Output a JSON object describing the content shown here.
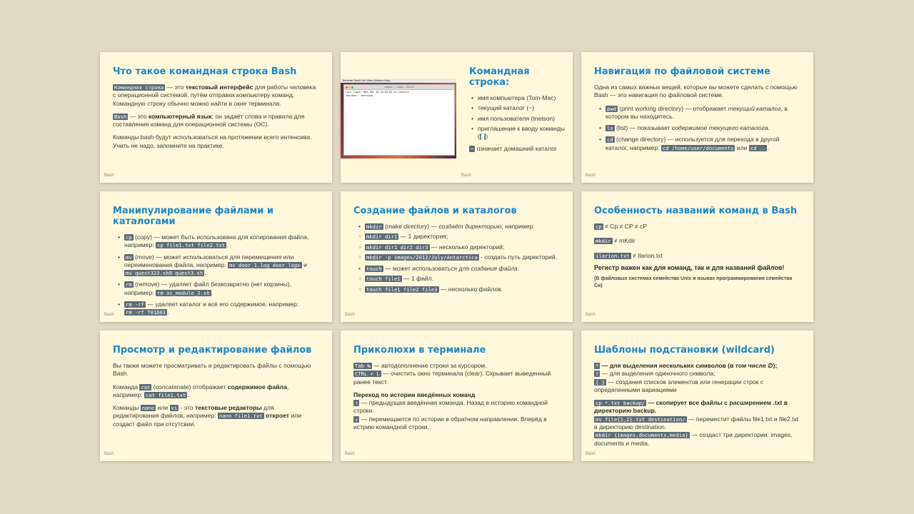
{
  "footer_label": "Bash",
  "s1": {
    "title": "Что такое командная строка Bash",
    "p1_code": "Командная строка",
    "p1_a": " — это ",
    "p1_b": "текстовый интерфейс",
    "p1_c": " для работы человека с операционной системой, путём отправки компьютеру команд. Командную строку обычно можно найти в окне терминала.",
    "p2_code": "Bash",
    "p2_a": " — это ",
    "p2_b": "компьютерный язык",
    "p2_c": "; он задаёт слова и правила для составления команд для операционной системы (ОС).",
    "p3": "Команды bash будут использоваться на протяжении всего интенсива. Учить не надо, запомните на практике."
  },
  "s2": {
    "title": "Командная строка:",
    "items": [
      "имя компьютера (Tom-Mac)",
      "текущий каталог (~)",
      "имя пользователя (tnelson)",
      "приглашение к вводу команды ("
    ],
    "cursor_close": ")",
    "note_code": "~",
    "note": " означает домашний каталог",
    "term_menu": "Terminal   Shell   Edit   View   Window   Help",
    "term_title": "tnelson — -bash — 80×24",
    "term_line1": "Last login: Mon Dec 16 14:03:02 on console",
    "term_line2": "Tom-Mac:~ tnelson$"
  },
  "s3": {
    "title": "Навигация по файловой системе",
    "intro": "Одна из самых важных вещей, которые вы можете сделать с помощью Bash — это навигация по файловой системе.",
    "i1_code": "pwd",
    "i1_a": " (print working directory) — отображает ",
    "i1_b": "текущий каталог",
    "i1_c": ", в котором вы находитесь.",
    "i2_code": "ls",
    "i2_a": " (list) — показывает ",
    "i2_b": "содержимое текущего каталога",
    "i2_c": ".",
    "i3_code": "cd",
    "i3_a": " (change directory) — используется для перехода в другой каталог, например: ",
    "i3_code2": "cd /home/user/documents",
    "i3_or": " или ",
    "i3_code3": "cd ..",
    "i3_end": "."
  },
  "s4": {
    "title": "Манипулирование файлами и каталогами",
    "i1_code": "cp",
    "i1_a": " (copy) — может быть использована для копирования файла, например: ",
    "i1_code2": "cp file1.txt file2.txt",
    "i1_end": ".",
    "i2_code": "mv",
    "i2_a": " (move) — может использоваться для перемещения или переименования файла, например: ",
    "i2_code2": "mv door_1.log door_logs",
    "i2_and": " и ",
    "i2_code3": "mv quest323.sh9 quest3.sh",
    "i2_end": ".",
    "i3_code": "rm",
    "i3_a": " (remove) — удаляет файл безвозвратно (нет корзины), например: ",
    "i3_code2": "rm ai_module_2.sh",
    "i3_end": ".",
    "i4_code": "rm -rf",
    "i4_a": " — удаляет каталог и всё его содержимое, например: ",
    "i4_code2": "rm -rf T01D01",
    "i4_end": "."
  },
  "s5": {
    "title": "Создание файлов и каталогов",
    "i1_code": "mkdir",
    "i1_a": " (make directory) — ",
    "i1_b": "создаёт директорию",
    "i1_c": ", например:",
    "s1_code": "mkdir dir1",
    "s1_a": " — 1 директория;",
    "s2_code": "mkdir dir1 dir2 dir3",
    "s2_a": " — несколько директорий;",
    "s3_code": "mkdir -p images/2012/July/Antarctica",
    "s3_a": " - создать путь директорий.",
    "i2_code": "touch",
    "i2_a": " — может использоваться для ",
    "i2_b": "создания файла",
    "i2_c": ":",
    "s4_code": "touch file1",
    "s4_a": " — 1 файл.",
    "s5_code": "touch file1 file2 file3",
    "s5_a": " — несколько файлов."
  },
  "s6": {
    "title": "Особенность названий команд в Bash",
    "l1_code": "cp",
    "l1": " ≠ Cp ≠ CP ≠ cP",
    "l2_code": "mkdir",
    "l2": " ≠ mKdir",
    "l3_code": "ilarion.txt",
    "l3": " ≠ Ilarion.txt",
    "bold": "Регистр важен как для команд, так и для названий файлов!",
    "note": "(В файловых системах семейства Unix и языках программирования семейства Си)"
  },
  "s7": {
    "title": "Просмотр и редактирование файлов",
    "p1": "Вы также можете просматривать и редактировать файлы с помощью Bash.",
    "p2_a": "Команда ",
    "p2_code": "cat",
    "p2_b": " (concatenate) отображает ",
    "p2_bold": "содержимое файла",
    "p2_c": ", например: ",
    "p2_code2": "cat file1.txt",
    "p2_end": ".",
    "p3_a": "Команды ",
    "p3_code": "nano",
    "p3_or": " или ",
    "p3_code2": "vi",
    "p3_b": " - это ",
    "p3_bold": "текстовые редакторы",
    "p3_c": " для редактирования файлов, например: ",
    "p3_code3": "nano file1.txt",
    "p3_bold2": " откроет",
    "p3_d": " или создаст файл при отсутсвии."
  },
  "s8": {
    "title": "Приколюхи в терминале",
    "l1_code": "Tab ↹",
    "l1": " — автодополнение строки за курсором.",
    "l2_code": "CTRL + L",
    "l2": " — очистить окно терминала (clear). Скрывает выведенный ранее текст.",
    "heading": "Переход по истории введённых команд",
    "l3_code": "↑",
    "l3": " — предыдущая введённая команда. Назад в историю командной строки.",
    "l4_code": "↓",
    "l4": " — перемещается по истории в обратном направлении. Вперёд в истрию командной строки."
  },
  "s9": {
    "title": "Шаблоны подстановки (wildcard)",
    "l1_code": "*",
    "l1": " — для выделения нескольких символов (в том числе ∅);",
    "l2_code": "?",
    "l2": " — для выделения одиночного символа;",
    "l3_code": "{ }",
    "l3": " — создания списков элементов или генерации строк с определенными вариациями",
    "l4_code": "cp *.txt backup/",
    "l4": " — скопирует все файлы с расширением .txt в директорию backup.",
    "l5_code": "mv file{1,2}.txt destination/",
    "l5": " — переместит файлы file1.txt и file2.txt в директорию destination.",
    "l6_code": "mkdir {images,documents,media}",
    "l6": " — создаст три директории: images, documents и media."
  }
}
